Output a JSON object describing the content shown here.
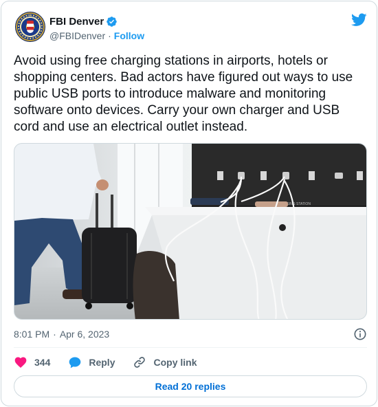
{
  "author": {
    "display_name": "FBI Denver",
    "handle": "@FBIDenver",
    "separator": "·",
    "follow_label": "Follow",
    "verified": true
  },
  "tweet": {
    "text": "Avoid using free charging stations in airports, hotels or shopping centers. Bad actors have figured out ways to use public USB ports to introduce malware and monitoring software onto devices. Carry your own charger and USB cord and use an electrical outlet instead.",
    "time": "8:01 PM",
    "date_separator": "·",
    "date": "Apr 6, 2023"
  },
  "photo": {
    "panel_label": "USB CHARGING STATION"
  },
  "actions": {
    "likes": "344",
    "reply_label": "Reply",
    "copy_link_label": "Copy link"
  },
  "replies_button": {
    "label": "Read 20 replies"
  },
  "colors": {
    "accent": "#1d9bf0",
    "link": "#006fd6",
    "like": "#f91880",
    "muted": "#536471",
    "text": "#0f1419",
    "border": "#cfd9de"
  },
  "icons": {
    "platform": "twitter-bird-icon",
    "verified": "verified-badge-icon",
    "info": "info-icon",
    "like": "heart-icon",
    "reply": "speech-bubble-icon",
    "copy_link": "link-icon"
  }
}
